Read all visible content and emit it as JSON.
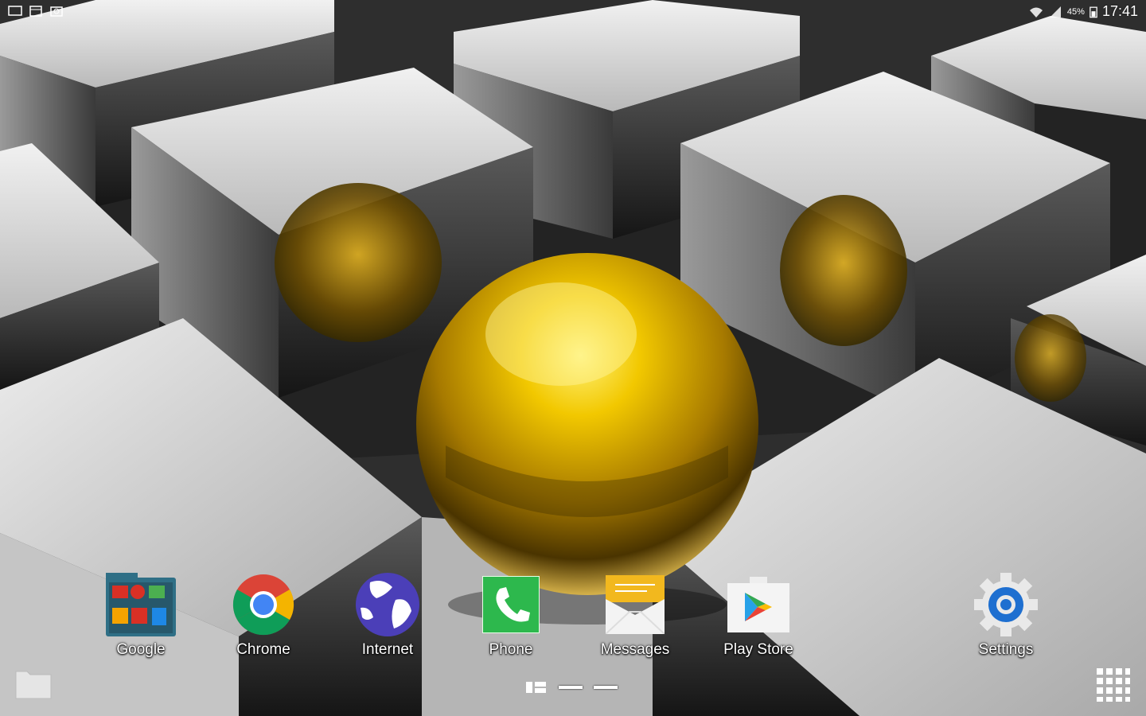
{
  "status_bar": {
    "time": "17:41",
    "battery_percent": "45%",
    "left_icons": [
      "screen-icon",
      "calendar-icon",
      "gallery-icon"
    ],
    "right_icons": [
      "wifi-icon",
      "signal-icon",
      "battery-icon"
    ]
  },
  "dock": {
    "apps": [
      {
        "label": "Google",
        "icon": "google-folder-icon"
      },
      {
        "label": "Chrome",
        "icon": "chrome-icon"
      },
      {
        "label": "Internet",
        "icon": "internet-globe-icon"
      },
      {
        "label": "Phone",
        "icon": "phone-icon"
      },
      {
        "label": "Messages",
        "icon": "messages-icon"
      },
      {
        "label": "Play Store",
        "icon": "play-store-icon"
      },
      {
        "label": "Settings",
        "icon": "settings-gear-icon"
      }
    ]
  },
  "pager": {
    "home_icon": "home-pages-icon",
    "pages": 2
  },
  "colors": {
    "gold": "#d9a800",
    "silver": "#d2d2d2",
    "dark": "#2a2a2a",
    "chrome_red": "#db4437",
    "phone_green": "#2db84d",
    "settings_blue": "#1e6fd0"
  }
}
